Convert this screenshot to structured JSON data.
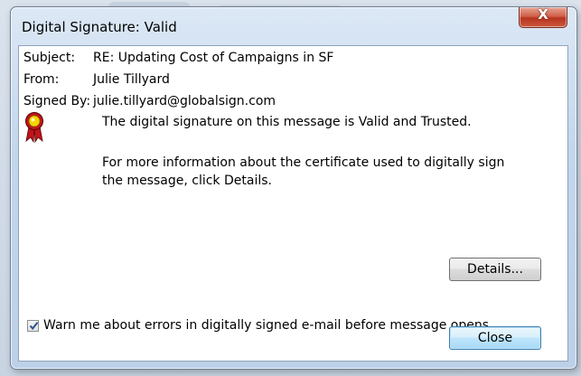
{
  "window": {
    "title": "Digital Signature: Valid",
    "close_glyph": "X"
  },
  "fields": {
    "subject_label": "Subject:",
    "subject_value": "RE: Updating Cost of Campaigns in SF",
    "from_label": "From:",
    "from_value": "Julie Tillyard",
    "signed_by_label": "Signed By:",
    "signed_by_value": "julie.tillyard@globalsign.com"
  },
  "status": {
    "icon": "certificate-ribbon-icon",
    "line1": "The digital signature on this message is Valid and Trusted.",
    "line2a": "For more information about the certificate used to digitally sign",
    "line2b": "the message, click Details."
  },
  "buttons": {
    "details": "Details...",
    "close": "Close"
  },
  "warn": {
    "label": "Warn me about errors in digitally signed e-mail before message opens.",
    "checked": true
  },
  "colors": {
    "ribbon_red": "#c0141a",
    "ribbon_gold": "#f5d400"
  }
}
